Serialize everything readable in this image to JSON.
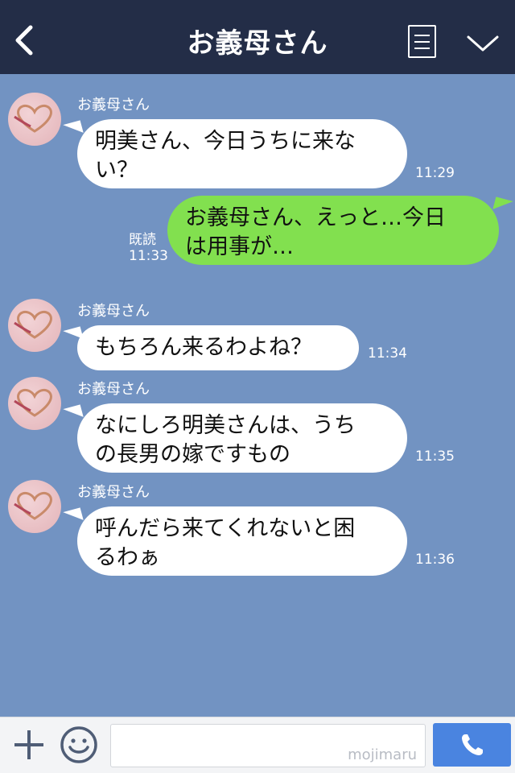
{
  "header": {
    "title": "お義母さん",
    "back_icon": "chevron-left-icon",
    "menu_icon": "menu-icon",
    "expand_icon": "chevron-down-icon"
  },
  "colors": {
    "header_bg": "#232d47",
    "chat_bg": "#7293c2",
    "incoming_bubble": "#ffffff",
    "outgoing_bubble": "#82e04f",
    "call_button": "#4a84e0"
  },
  "messages": [
    {
      "sender": "お義母さん",
      "line1": "明美さん、今日うちに来な",
      "line2": "い？",
      "time": "11:29"
    },
    {
      "line1": "お義母さん、えっと…今日",
      "line2": "は用事が…",
      "read_label": "既読",
      "time": "11:33"
    },
    {
      "sender": "お義母さん",
      "line1": "もちろん来るわよね？",
      "time": "11:34"
    },
    {
      "sender": "お義母さん",
      "line1": "なにしろ明美さんは、うち",
      "line2": "の長男の嫁ですもの",
      "time": "11:35"
    },
    {
      "sender": "お義母さん",
      "line1": "呼んだら来てくれないと困",
      "line2": "るわぁ",
      "time": "11:36"
    }
  ],
  "footer": {
    "input_value": "",
    "watermark": "mojimaru",
    "plus_icon": "plus-icon",
    "emoji_icon": "smiley-icon",
    "call_icon": "phone-icon"
  }
}
